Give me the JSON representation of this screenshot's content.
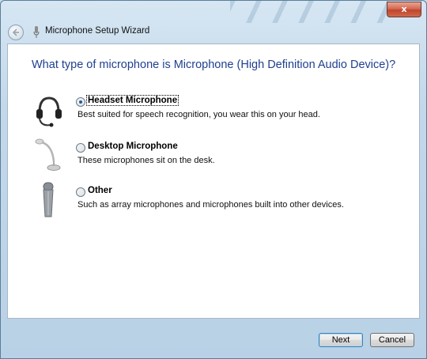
{
  "window": {
    "title": "Microphone Setup Wizard",
    "close_glyph": "x"
  },
  "main": {
    "question": "What type of microphone is Microphone (High Definition Audio Device)?",
    "options": [
      {
        "label": "Headset Microphone",
        "description": "Best suited for speech recognition, you wear this on your head.",
        "selected": true,
        "icon": "headset-icon"
      },
      {
        "label": "Desktop Microphone",
        "description": "These microphones sit on the desk.",
        "selected": false,
        "icon": "desktop-microphone-icon"
      },
      {
        "label": "Other",
        "description": "Such as array microphones and microphones built into other devices.",
        "selected": false,
        "icon": "handheld-microphone-icon"
      }
    ]
  },
  "footer": {
    "next_label": "Next",
    "cancel_label": "Cancel"
  },
  "colors": {
    "heading": "#1f3f8f",
    "chrome": "#c3d8ea",
    "close": "#c0442c"
  }
}
